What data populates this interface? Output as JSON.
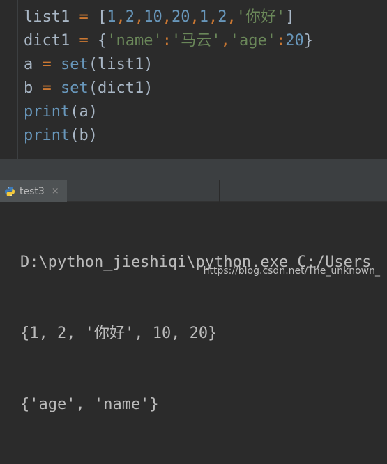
{
  "editor": {
    "lines": [
      {
        "parts": [
          {
            "t": "list1",
            "c": "plain"
          },
          {
            "t": " = ",
            "c": "op"
          },
          {
            "t": "[",
            "c": "plain"
          },
          {
            "t": "1",
            "c": "num"
          },
          {
            "t": ",",
            "c": "op"
          },
          {
            "t": "2",
            "c": "num"
          },
          {
            "t": ",",
            "c": "op"
          },
          {
            "t": "10",
            "c": "num"
          },
          {
            "t": ",",
            "c": "op"
          },
          {
            "t": "20",
            "c": "num"
          },
          {
            "t": ",",
            "c": "op"
          },
          {
            "t": "1",
            "c": "num"
          },
          {
            "t": ",",
            "c": "op"
          },
          {
            "t": "2",
            "c": "num"
          },
          {
            "t": ",",
            "c": "op"
          },
          {
            "t": "'你好'",
            "c": "str"
          },
          {
            "t": "]",
            "c": "plain"
          }
        ]
      },
      {
        "parts": [
          {
            "t": "dict1",
            "c": "plain"
          },
          {
            "t": " = ",
            "c": "op"
          },
          {
            "t": "{",
            "c": "plain"
          },
          {
            "t": "'name'",
            "c": "str"
          },
          {
            "t": ":",
            "c": "op"
          },
          {
            "t": "'马云'",
            "c": "str"
          },
          {
            "t": ",",
            "c": "op"
          },
          {
            "t": "'age'",
            "c": "str"
          },
          {
            "t": ":",
            "c": "op"
          },
          {
            "t": "20",
            "c": "num"
          },
          {
            "t": "}",
            "c": "plain"
          }
        ]
      },
      {
        "parts": [
          {
            "t": "a",
            "c": "plain"
          },
          {
            "t": " = ",
            "c": "op"
          },
          {
            "t": "set",
            "c": "num"
          },
          {
            "t": "(list1)",
            "c": "plain"
          }
        ]
      },
      {
        "parts": [
          {
            "t": "b",
            "c": "plain"
          },
          {
            "t": " = ",
            "c": "op"
          },
          {
            "t": "set",
            "c": "num"
          },
          {
            "t": "(dict1)",
            "c": "plain"
          }
        ]
      },
      {
        "parts": [
          {
            "t": "print",
            "c": "num"
          },
          {
            "t": "(a)",
            "c": "plain"
          }
        ]
      },
      {
        "parts": [
          {
            "t": "print",
            "c": "num"
          },
          {
            "t": "(b)",
            "c": "plain"
          }
        ]
      }
    ]
  },
  "run_panel": {
    "tab_label": "test3",
    "close_glyph": "×"
  },
  "console": {
    "lines": [
      "D:\\python_jieshiqi\\python.exe C:/Users",
      "{1, 2, '你好', 10, 20}",
      "{'age', 'name'}"
    ]
  },
  "watermark": "https://blog.csdn.net/The_unknown_",
  "colors": {
    "background": "#2b2b2b",
    "keyword_orange": "#cc7832",
    "number_blue": "#6897bb",
    "string_green": "#6a8759",
    "text": "#a9b7c6"
  }
}
